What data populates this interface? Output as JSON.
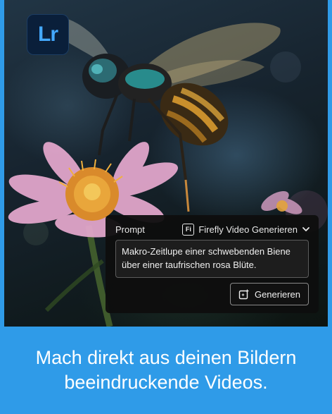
{
  "logo": {
    "text": "Lr",
    "icon": "lightroom-logo-icon"
  },
  "prompt_panel": {
    "label": "Prompt",
    "model_icon_text": "Fi",
    "model_label": "Firefly Video Generieren",
    "model_icon": "firefly-icon",
    "dropdown_icon": "chevron-down-icon",
    "prompt_text": "Makro-Zeitlupe einer schwebenden Biene über einer taufrischen rosa Blüte.",
    "generate_label": "Generieren",
    "generate_icon": "generate-sparkle-icon"
  },
  "banner": {
    "line1": "Mach direkt aus deinen Bildern",
    "line2": "beeindruckende Videos."
  },
  "colors": {
    "banner_bg": "#2f9be8",
    "panel_bg": "#0e0e0e",
    "logo_bg": "#0a1f3a",
    "logo_text": "#44a9ff"
  }
}
